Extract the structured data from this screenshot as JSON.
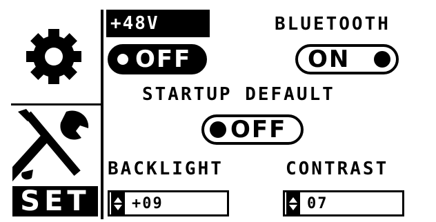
{
  "sidebar": {
    "settings_icon": "gear-icon",
    "tools_icon": "wrench-screwdriver-icon",
    "mode_label": "SET"
  },
  "power": {
    "voltage_label": "+48V",
    "toggle_state": "OFF"
  },
  "bluetooth": {
    "label": "BLUETOOTH",
    "toggle_state": "ON"
  },
  "startup_default": {
    "label": "STARTUP DEFAULT",
    "toggle_state": "OFF"
  },
  "backlight": {
    "label": "BACKLIGHT",
    "value": "+09"
  },
  "contrast": {
    "label": "CONTRAST",
    "value": "07"
  },
  "colors": {
    "foreground": "#000000",
    "background": "#ffffff"
  }
}
